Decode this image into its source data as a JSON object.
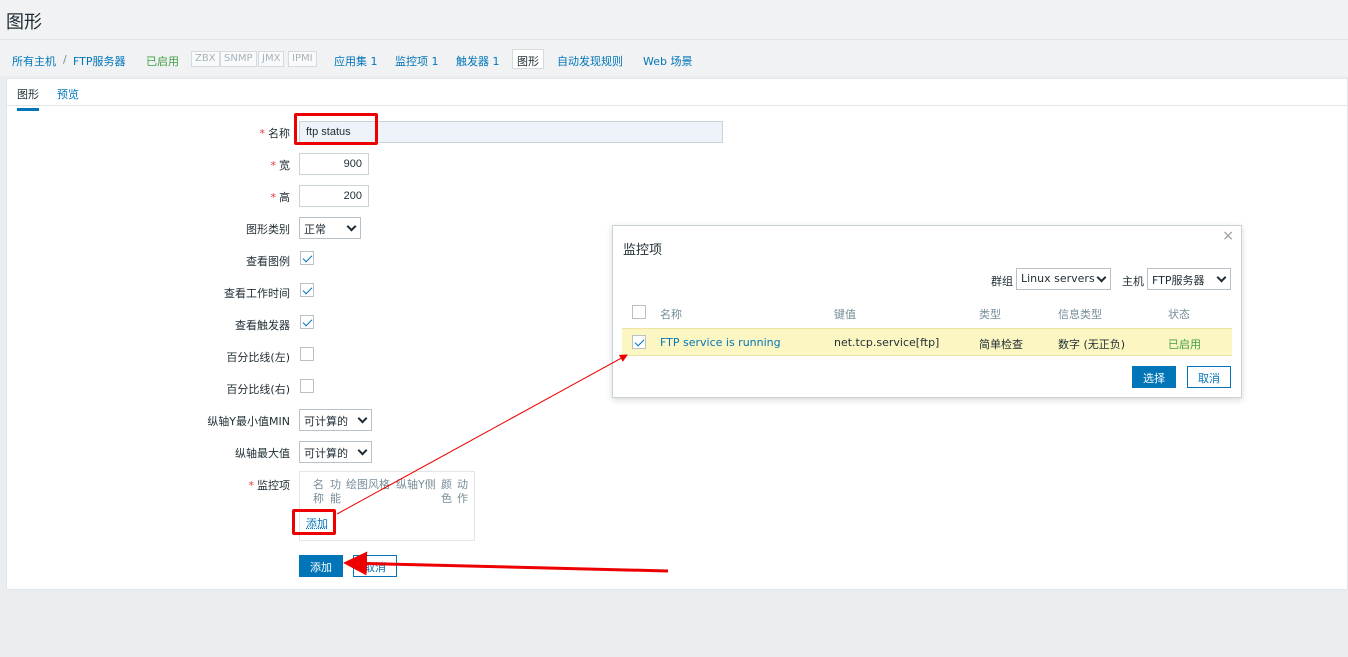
{
  "page_title": "图形",
  "nav": {
    "all_hosts": "所有主机",
    "sep": "/",
    "host": "FTP服务器",
    "status": "已启用",
    "protocols": [
      "ZBX",
      "SNMP",
      "JMX",
      "IPMI"
    ],
    "applications": "应用集 1",
    "items": "监控项 1",
    "triggers": "触发器 1",
    "graphs": "图形",
    "discovery": "自动发现规则",
    "web": "Web 场景"
  },
  "tabs": [
    "图形",
    "预览"
  ],
  "form": {
    "required_mark": "*",
    "name_label": "名称",
    "name_value": "ftp status",
    "width_label": "宽",
    "width_value": "900",
    "height_label": "高",
    "height_value": "200",
    "graph_type_label": "图形类别",
    "graph_type_value": "正常",
    "show_legend_label": "查看图例",
    "show_worktime_label": "查看工作时间",
    "show_triggers_label": "查看触发器",
    "percentile_left_label": "百分比线(左)",
    "percentile_right_label": "百分比线(右)",
    "ymin_label": "纵轴Y最小值MIN",
    "ymin_value": "可计算的",
    "ymax_label": "纵轴最大值",
    "ymax_value": "可计算的",
    "items_label": "监控项",
    "items_columns": [
      "名称",
      "功能",
      "绘图风格",
      "纵轴Y侧",
      "颜色",
      "动作"
    ],
    "add_link": "添加",
    "add_button": "添加",
    "cancel_button": "取消"
  },
  "modal": {
    "title": "监控项",
    "close": "×",
    "group_label": "群组",
    "group_value": "Linux servers",
    "host_label": "主机",
    "host_value": "FTP服务器",
    "columns": [
      "名称",
      "键值",
      "类型",
      "信息类型",
      "状态"
    ],
    "rows": [
      {
        "name": "FTP service is running",
        "key": "net.tcp.service[ftp]",
        "type": "简单检查",
        "info_type": "数字 (无正负)",
        "status": "已启用"
      }
    ],
    "select_button": "选择",
    "cancel_button": "取消"
  },
  "colors": {
    "accent": "#0275b8",
    "enabled": "#429e47",
    "highlight": "#fcf7c2",
    "annotation": "#e00000"
  }
}
